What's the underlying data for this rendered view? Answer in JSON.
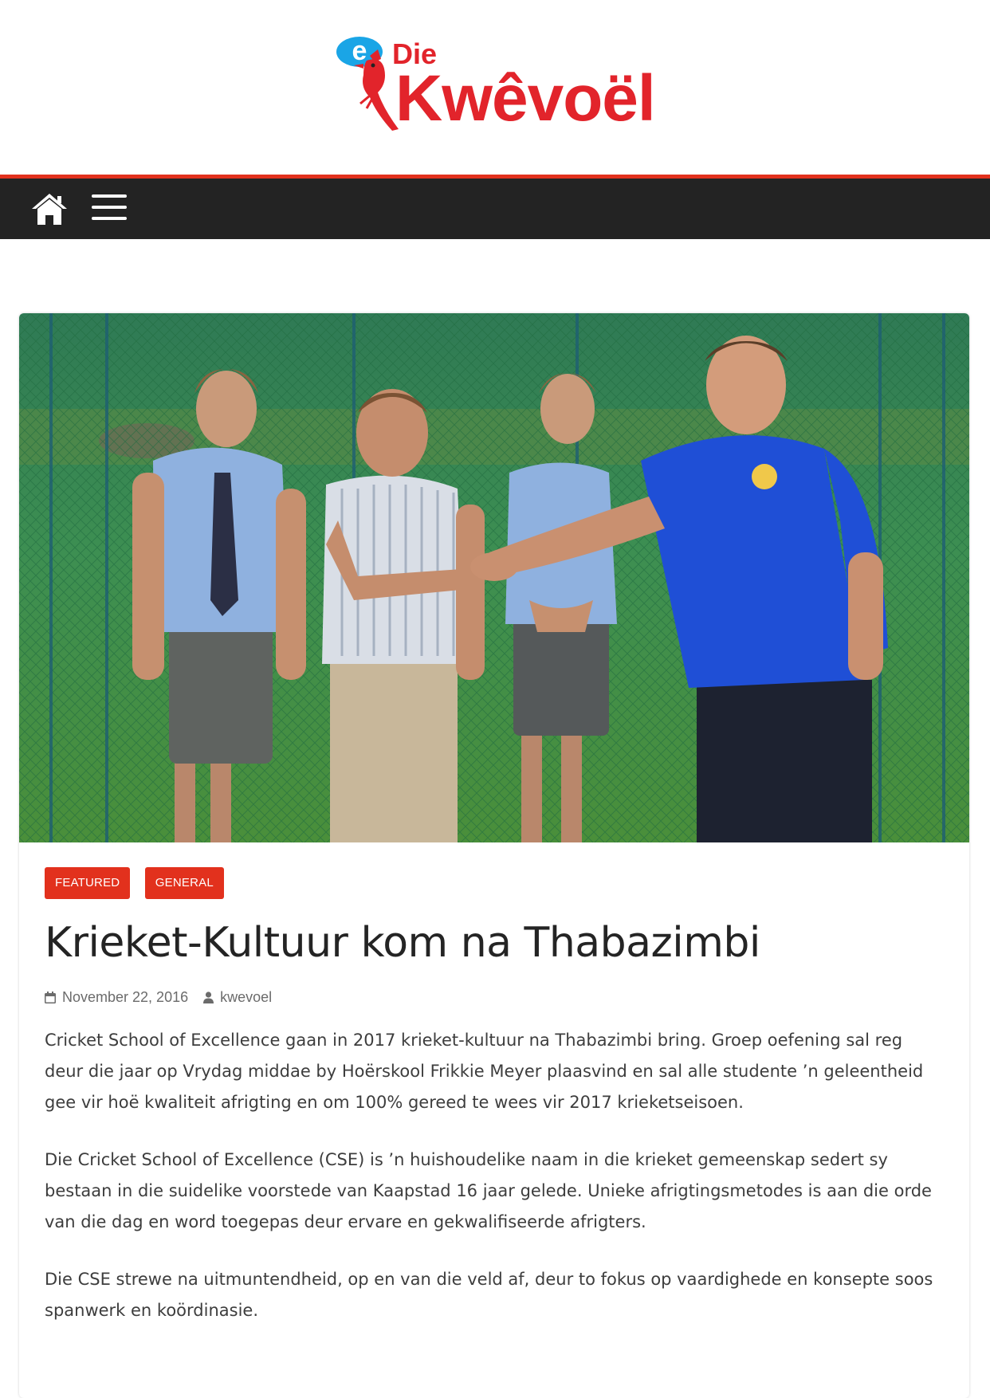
{
  "logo": {
    "badge_letter": "e",
    "line1": "Die",
    "line2": "Kwêvoël",
    "colors": {
      "red": "#e2242b",
      "blue": "#1aa5e6"
    }
  },
  "nav": {
    "home_icon": "home-icon",
    "menu_icon": "hamburger-menu-icon",
    "bar_color": "#232323",
    "accent_color": "#e2311d"
  },
  "article": {
    "categories": [
      "FEATURED",
      "GENERAL"
    ],
    "title": "Krieket-Kultuur kom na Thabazimbi",
    "date": "November 22, 2016",
    "author": "kwevoel",
    "paragraphs": [
      "Cricket School of Excellence gaan in 2017 krieket-kultuur na Thabazimbi bring. Groep oefening sal reg deur die jaar op Vrydag middae by Hoërskool Frikkie Meyer plaasvind en sal alle studente ’n geleentheid gee vir hoë kwaliteit afrigting en om 100% gereed te wees vir 2017 krieketseisoen.",
      "Die Cricket School of Excellence (CSE) is ’n huishoudelike naam in die krieket gemeenskap sedert sy bestaan in die suidelike voorstede van Kaapstad 16 jaar gelede. Unieke afrigtingsmetodes is aan die orde van die dag en word toegepas deur ervare en gekwalifiseerde afrigters.",
      "Die CSE strewe na uitmuntendheid, op en van die veld af, deur to fokus op vaardighede en konsepte soos spanwerk en koördinasie."
    ],
    "tag_color": "#e2311d"
  }
}
